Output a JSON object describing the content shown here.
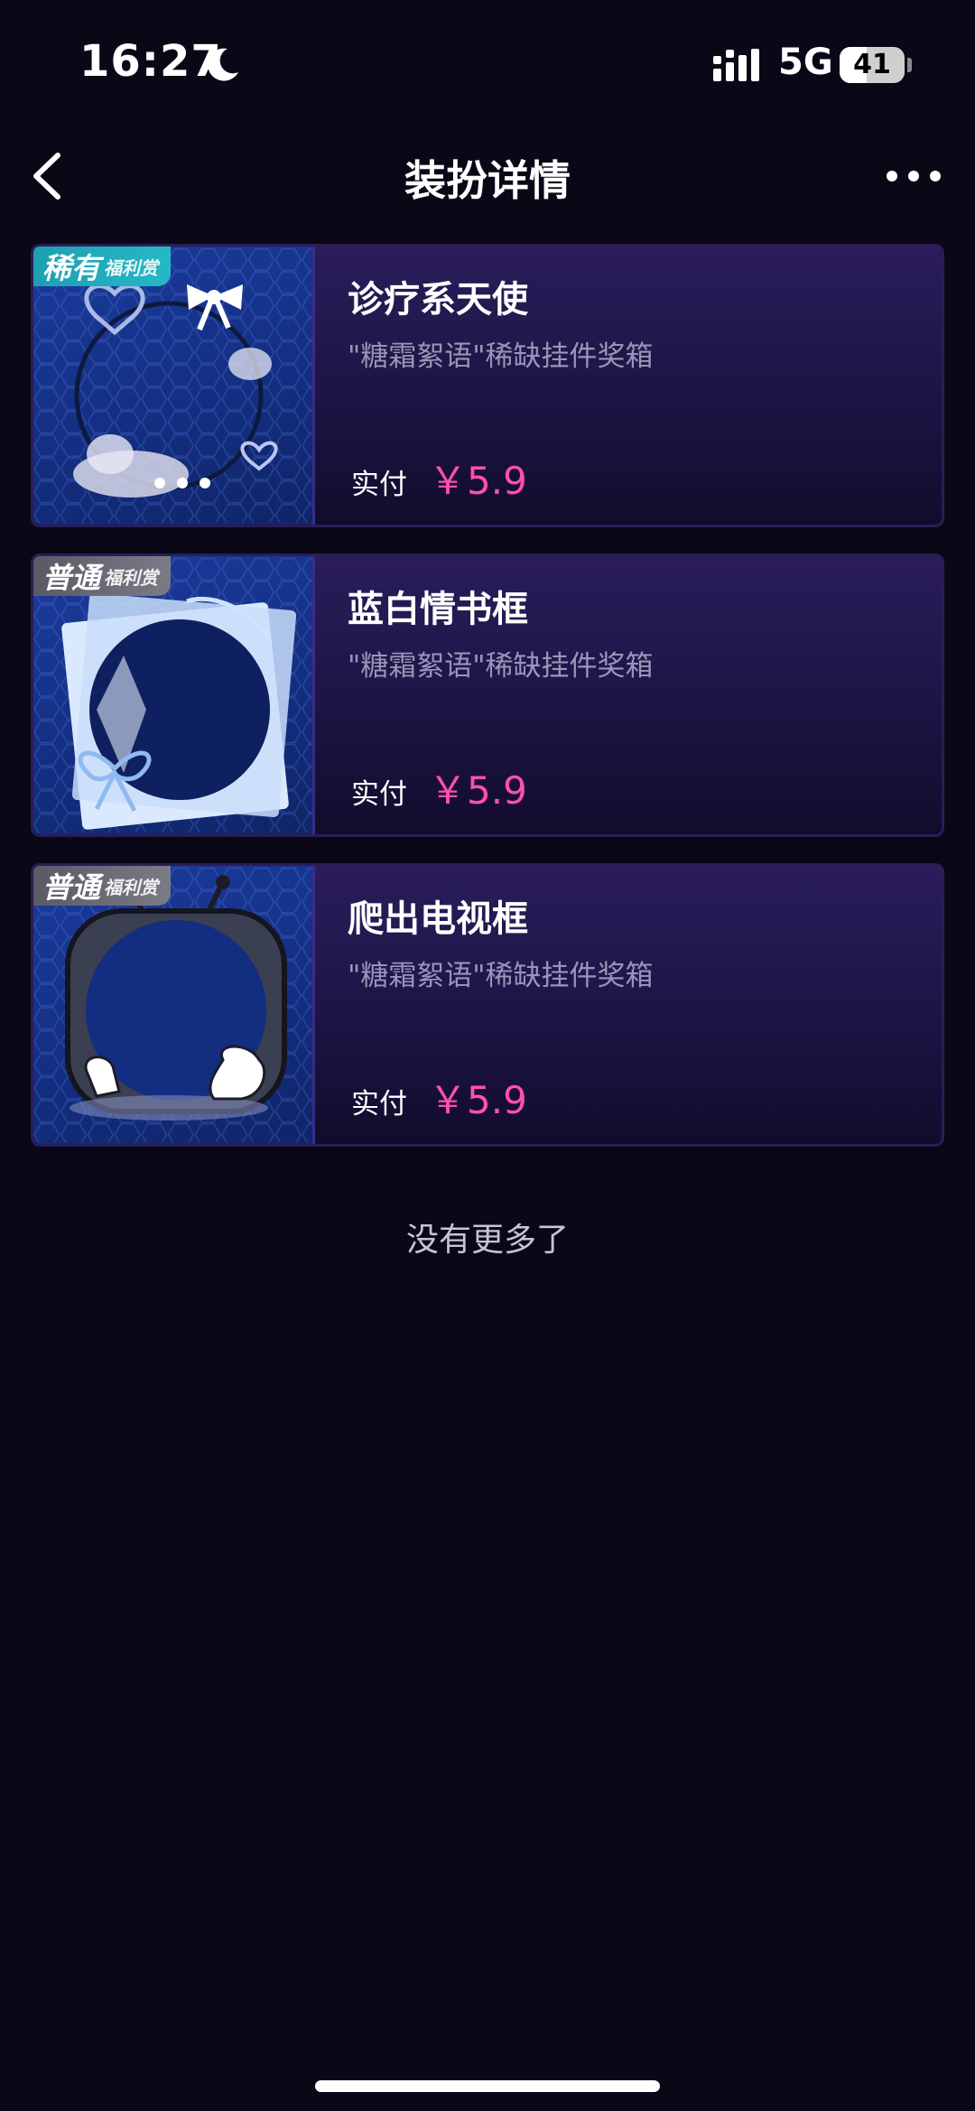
{
  "status_bar": {
    "time": "16:27",
    "network": "5G",
    "battery": "41",
    "battery_fraction": 0.41,
    "icons": [
      "moon-icon",
      "signal-icon"
    ]
  },
  "nav": {
    "title": "装扮详情",
    "back_icon": "chevron-left-icon",
    "more_icon": "more-horizontal-icon"
  },
  "items": [
    {
      "badge_main": "稀有",
      "badge_sub": "福利赏",
      "badge_type": "rare",
      "name": "诊疗系天使",
      "source": "\"糖霜絮语\"稀缺挂件奖箱",
      "price_label": "实付",
      "price": "￥5.9",
      "art": "angel-frame"
    },
    {
      "badge_main": "普通",
      "badge_sub": "福利赏",
      "badge_type": "common",
      "name": "蓝白情书框",
      "source": "\"糖霜絮语\"稀缺挂件奖箱",
      "price_label": "实付",
      "price": "￥5.9",
      "art": "love-letter-frame"
    },
    {
      "badge_main": "普通",
      "badge_sub": "福利赏",
      "badge_type": "common",
      "name": "爬出电视框",
      "source": "\"糖霜絮语\"稀缺挂件奖箱",
      "price_label": "实付",
      "price": "￥5.9",
      "art": "tv-frame"
    }
  ],
  "end_text": "没有更多了",
  "colors": {
    "background": "#0a0716",
    "price": "#ff4fb0",
    "rare_badge": "#1e9fb2",
    "common_badge": "#6b6b76"
  }
}
